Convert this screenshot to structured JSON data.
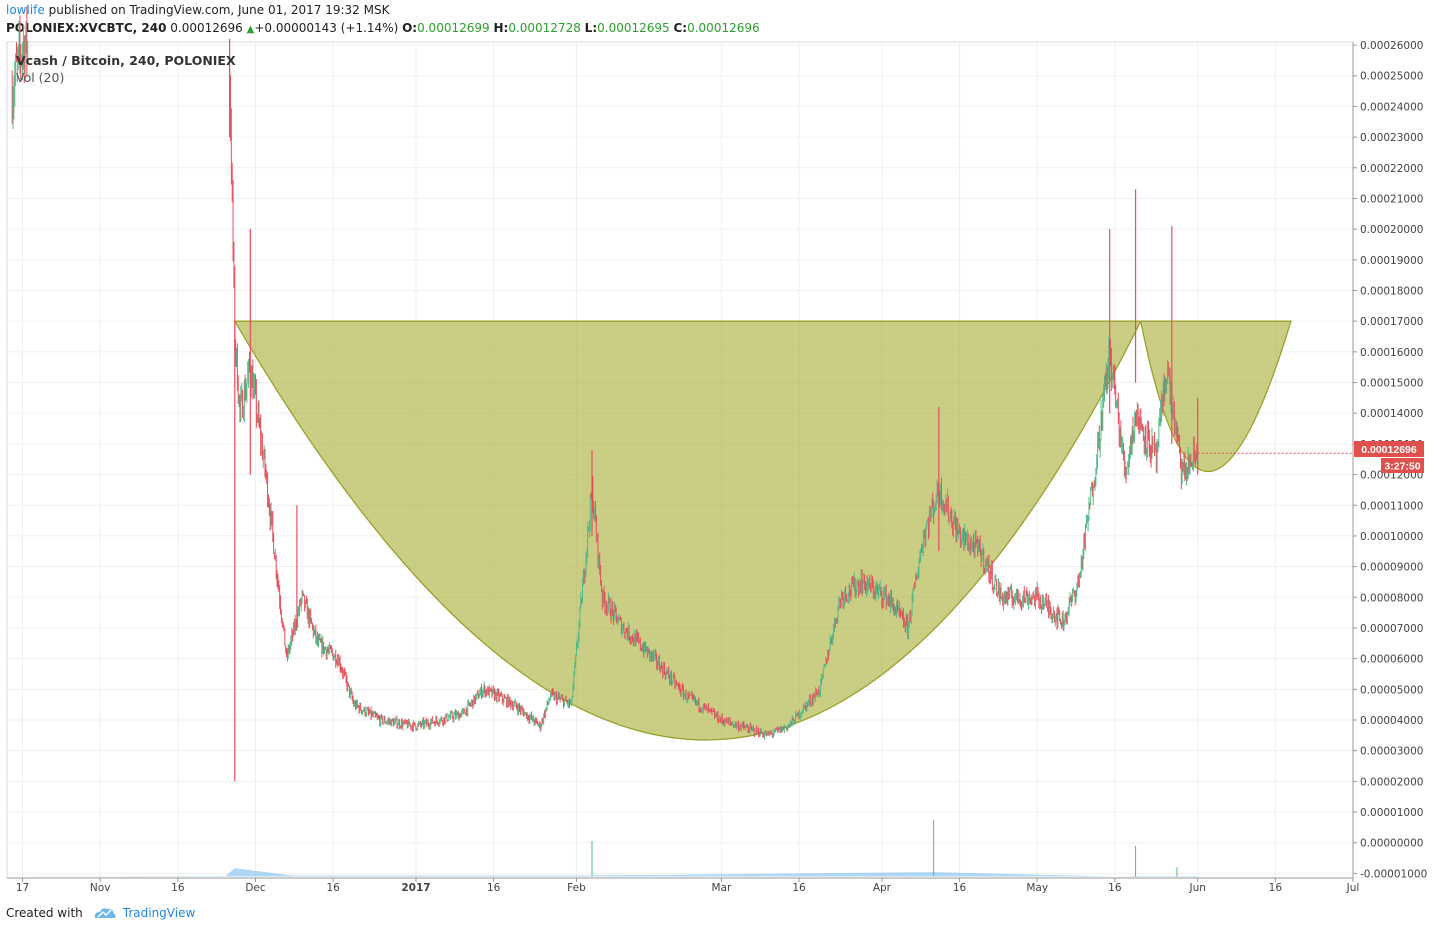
{
  "header": {
    "publisher": "lowlife",
    "published_text": "published on TradingView.com, June 01, 2017 19:32 MSK",
    "symbol": "POLONIEX:XVCBTC, 240",
    "price": "0.00012696",
    "change": "+0.00000143 (+1.14%)",
    "o_label": "O:",
    "o_value": "0.00012699",
    "h_label": "H:",
    "h_value": "0.00012728",
    "l_label": "L:",
    "l_value": "0.00012695",
    "c_label": "C:",
    "c_value": "0.00012696"
  },
  "legend": {
    "series_title": "Vcash / Bitcoin, 240, POLONIEX",
    "volume_title": "Vol (20)"
  },
  "price_badge": {
    "price": "0.00012696",
    "countdown": "3:27:50"
  },
  "footer": {
    "created_with": "Created with",
    "brand": "TradingView"
  },
  "colors": {
    "up": "#53b987",
    "down": "#eb4d5c",
    "volume": "#6fb6ea",
    "pattern_fill": "#a8b038",
    "pattern_stroke": "#9aa12a",
    "badge": "#e0504d",
    "grid": "#f0f0f0"
  },
  "chart_data": {
    "type": "candlestick",
    "title": "Vcash / Bitcoin, 240, POLONIEX",
    "x_ticks": [
      "17",
      "Nov",
      "16",
      "Dec",
      "16",
      "2017",
      "16",
      "Feb",
      "Mar",
      "16",
      "Apr",
      "16",
      "May",
      "16",
      "Jun",
      "16",
      "Jul"
    ],
    "x_tick_dates": [
      "2016-10-17",
      "2016-11-01",
      "2016-11-16",
      "2016-12-01",
      "2016-12-16",
      "2017-01-01",
      "2017-01-16",
      "2017-02-01",
      "2017-03-01",
      "2017-03-16",
      "2017-04-01",
      "2017-04-16",
      "2017-05-01",
      "2017-05-16",
      "2017-06-01",
      "2017-06-16",
      "2017-07-01"
    ],
    "x_range": [
      "2016-10-14",
      "2017-07-01"
    ],
    "y_ticks": [
      "0.00026000",
      "0.00025000",
      "0.00024000",
      "0.00023000",
      "0.00022000",
      "0.00021000",
      "0.00020000",
      "0.00019000",
      "0.00018000",
      "0.00017000",
      "0.00016000",
      "0.00015000",
      "0.00014000",
      "0.00013000",
      "0.00012000",
      "0.00011000",
      "0.00010000",
      "0.00009000",
      "0.00008000",
      "0.00007000",
      "0.00006000",
      "0.00005000",
      "0.00004000",
      "0.00003000",
      "0.00002000",
      "0.00001000",
      "0.00000000",
      "-0.00001000"
    ],
    "ylim": [
      -1.15e-05,
      0.000261
    ],
    "price_path": [
      {
        "date": "2016-10-15",
        "price": 0.000245
      },
      {
        "date": "2016-10-17",
        "price": 0.00026
      },
      {
        "date": "2016-11-26",
        "price": 0.00025
      },
      {
        "date": "2016-11-27",
        "price": 0.000165
      },
      {
        "date": "2016-11-28",
        "price": 0.00014
      },
      {
        "date": "2016-11-30",
        "price": 0.000155
      },
      {
        "date": "2016-12-03",
        "price": 0.00012
      },
      {
        "date": "2016-12-05",
        "price": 9e-05
      },
      {
        "date": "2016-12-07",
        "price": 6e-05
      },
      {
        "date": "2016-12-10",
        "price": 8e-05
      },
      {
        "date": "2016-12-13",
        "price": 6.5e-05
      },
      {
        "date": "2016-12-17",
        "price": 6e-05
      },
      {
        "date": "2016-12-20",
        "price": 4.5e-05
      },
      {
        "date": "2016-12-25",
        "price": 4e-05
      },
      {
        "date": "2017-01-01",
        "price": 3.8e-05
      },
      {
        "date": "2017-01-10",
        "price": 4.2e-05
      },
      {
        "date": "2017-01-14",
        "price": 5e-05
      },
      {
        "date": "2017-01-20",
        "price": 4.5e-05
      },
      {
        "date": "2017-01-25",
        "price": 3.8e-05
      },
      {
        "date": "2017-01-27",
        "price": 4.8e-05
      },
      {
        "date": "2017-01-31",
        "price": 4.5e-05
      },
      {
        "date": "2017-02-02",
        "price": 8e-05
      },
      {
        "date": "2017-02-04",
        "price": 0.000115
      },
      {
        "date": "2017-02-06",
        "price": 8e-05
      },
      {
        "date": "2017-02-10",
        "price": 7e-05
      },
      {
        "date": "2017-02-16",
        "price": 6e-05
      },
      {
        "date": "2017-02-22",
        "price": 4.8e-05
      },
      {
        "date": "2017-03-01",
        "price": 4e-05
      },
      {
        "date": "2017-03-10",
        "price": 3.5e-05
      },
      {
        "date": "2017-03-14",
        "price": 3.8e-05
      },
      {
        "date": "2017-03-20",
        "price": 5e-05
      },
      {
        "date": "2017-03-24",
        "price": 8e-05
      },
      {
        "date": "2017-03-28",
        "price": 8.5e-05
      },
      {
        "date": "2017-04-02",
        "price": 8e-05
      },
      {
        "date": "2017-04-06",
        "price": 7e-05
      },
      {
        "date": "2017-04-09",
        "price": 0.0001
      },
      {
        "date": "2017-04-12",
        "price": 0.000115
      },
      {
        "date": "2017-04-16",
        "price": 0.0001
      },
      {
        "date": "2017-04-20",
        "price": 9.5e-05
      },
      {
        "date": "2017-04-24",
        "price": 8e-05
      },
      {
        "date": "2017-05-01",
        "price": 8e-05
      },
      {
        "date": "2017-05-06",
        "price": 7.2e-05
      },
      {
        "date": "2017-05-09",
        "price": 8.5e-05
      },
      {
        "date": "2017-05-12",
        "price": 0.00012
      },
      {
        "date": "2017-05-15",
        "price": 0.00016
      },
      {
        "date": "2017-05-18",
        "price": 0.00012
      },
      {
        "date": "2017-05-20",
        "price": 0.00014
      },
      {
        "date": "2017-05-24",
        "price": 0.000125
      },
      {
        "date": "2017-05-26",
        "price": 0.000155
      },
      {
        "date": "2017-05-29",
        "price": 0.00012
      },
      {
        "date": "2017-06-01",
        "price": 0.00012696
      }
    ],
    "spikes": [
      {
        "date": "2016-11-26",
        "high": 0.000262,
        "low": 0.00023
      },
      {
        "date": "2016-11-27",
        "high": 0.00017,
        "low": 2e-05
      },
      {
        "date": "2016-11-30",
        "high": 0.0002,
        "low": 0.00012
      },
      {
        "date": "2016-12-09",
        "high": 0.00011,
        "low": 7e-05
      },
      {
        "date": "2017-02-04",
        "high": 0.000128,
        "low": 0.0001
      },
      {
        "date": "2017-04-12",
        "high": 0.000142,
        "low": 9.5e-05
      },
      {
        "date": "2017-05-15",
        "high": 0.0002,
        "low": 0.00014
      },
      {
        "date": "2017-05-20",
        "high": 0.000213,
        "low": 0.00015
      },
      {
        "date": "2017-05-27",
        "high": 0.000201,
        "low": 0.00013
      },
      {
        "date": "2017-06-01",
        "high": 0.000145,
        "low": 0.00012
      }
    ],
    "volume": [
      {
        "date": "2016-11-27",
        "value": 2e-06
      },
      {
        "date": "2016-12-08",
        "value": 5e-07
      },
      {
        "date": "2017-02-03",
        "value": 5e-07
      },
      {
        "date": "2017-04-11",
        "value": 1.2e-06
      },
      {
        "date": "2017-05-20",
        "value": 2e-07
      }
    ],
    "volume_spikes": [
      {
        "date": "2017-02-04",
        "value": 1.2e-05
      },
      {
        "date": "2017-04-11",
        "value": 1.9e-05
      },
      {
        "date": "2017-05-20",
        "value": 1.05e-05
      },
      {
        "date": "2017-05-28",
        "value": 3.5e-06
      }
    ],
    "annotation": {
      "type": "cup_and_handle",
      "rim_price": 0.00017,
      "cup": {
        "start": "2016-11-27",
        "bottom_date": "2017-02-26",
        "bottom_price": 3.35e-05,
        "end": "2017-05-21"
      },
      "handle": {
        "start": "2017-05-21",
        "bottom_date": "2017-06-03",
        "bottom_price": 0.000121,
        "end": "2017-06-19"
      }
    },
    "last_price": 0.00012696
  }
}
